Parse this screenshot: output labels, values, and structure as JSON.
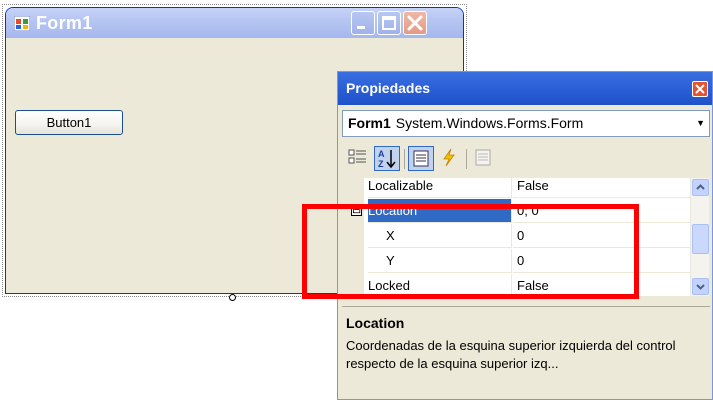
{
  "form": {
    "title": "Form1",
    "button_label": "Button1"
  },
  "properties": {
    "title": "Propiedades",
    "object_name": "Form1",
    "object_type": "System.Windows.Forms.Form",
    "rows": [
      {
        "name": "Localizable",
        "value": "False"
      },
      {
        "name": "Location",
        "value": "0; 0",
        "expander": "⊟"
      },
      {
        "name": "X",
        "value": "0"
      },
      {
        "name": "Y",
        "value": "0"
      },
      {
        "name": "Locked",
        "value": "False"
      }
    ],
    "description_title": "Location",
    "description_text": "Coordenadas de la esquina superior izquierda del control respecto de la esquina superior izq..."
  },
  "colors": {
    "highlight": "#ff0000",
    "selection": "#316ac5",
    "titlebar_active": "#2a5fd8"
  }
}
